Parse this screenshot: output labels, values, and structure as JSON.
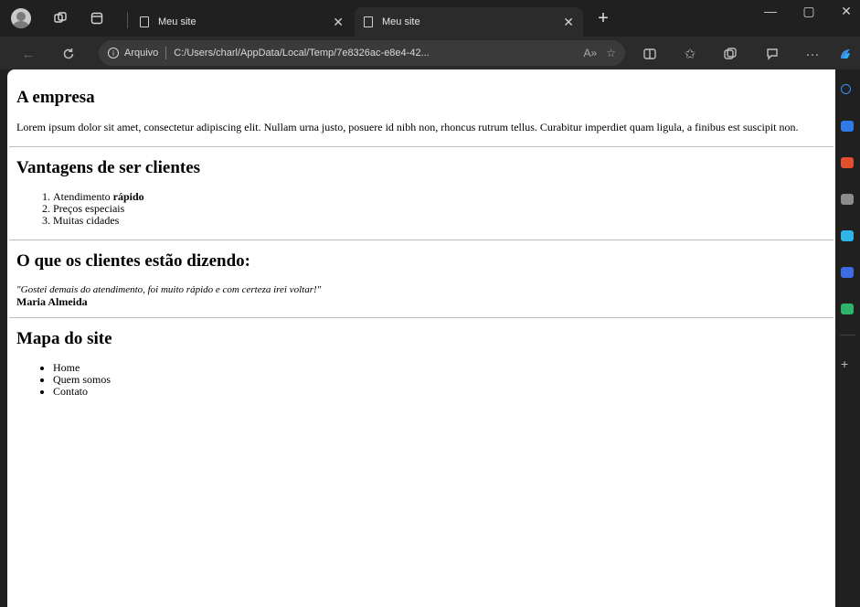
{
  "browser": {
    "tabs": [
      {
        "title": "Meu site",
        "active": false
      },
      {
        "title": "Meu site",
        "active": true
      }
    ],
    "address": {
      "scheme_label": "Arquivo",
      "url": "C:/Users/charl/AppData/Local/Temp/7e8326ac-e8e4-42..."
    },
    "icons": {
      "profile": "profile-icon",
      "workspaces": "workspaces-icon",
      "tab_actions": "tab-actions-icon",
      "back": "back-arrow-icon",
      "refresh": "refresh-icon",
      "read_aloud": "read-aloud-icon",
      "favorite": "star-icon",
      "split_screen": "split-screen-icon",
      "favorites": "favorites-icon",
      "collections": "collections-icon",
      "feedback": "feedback-icon",
      "more": "more-icon"
    },
    "sidebar_accent_colors": [
      "#3b8ef0",
      "#2f7be5",
      "#e0502e",
      "#8c8c8c",
      "#2fb4e8",
      "#3d6be0",
      "#2fb46b"
    ]
  },
  "page": {
    "sections": [
      {
        "heading": "A empresa",
        "paragraph": "Lorem ipsum dolor sit amet, consectetur adipiscing elit. Nullam urna justo, posuere id nibh non, rhoncus rutrum tellus. Curabitur imperdiet quam ligula, a finibus est suscipit non."
      },
      {
        "heading": "Vantagens de ser clientes",
        "ordered_list": [
          {
            "text": "Atendimento ",
            "bold": "rápido"
          },
          {
            "text": "Preços especiais",
            "bold": ""
          },
          {
            "text": "Muitas cidades",
            "bold": ""
          }
        ]
      },
      {
        "heading": "O que os clientes estão dizendo:",
        "quote": "\"Gostei demais do atendimento, foi muito rápido e com certeza irei voltar!\"",
        "author": "Maria Almeida"
      },
      {
        "heading": "Mapa do site",
        "unordered_list": [
          "Home",
          "Quem somos",
          "Contato"
        ]
      }
    ]
  }
}
